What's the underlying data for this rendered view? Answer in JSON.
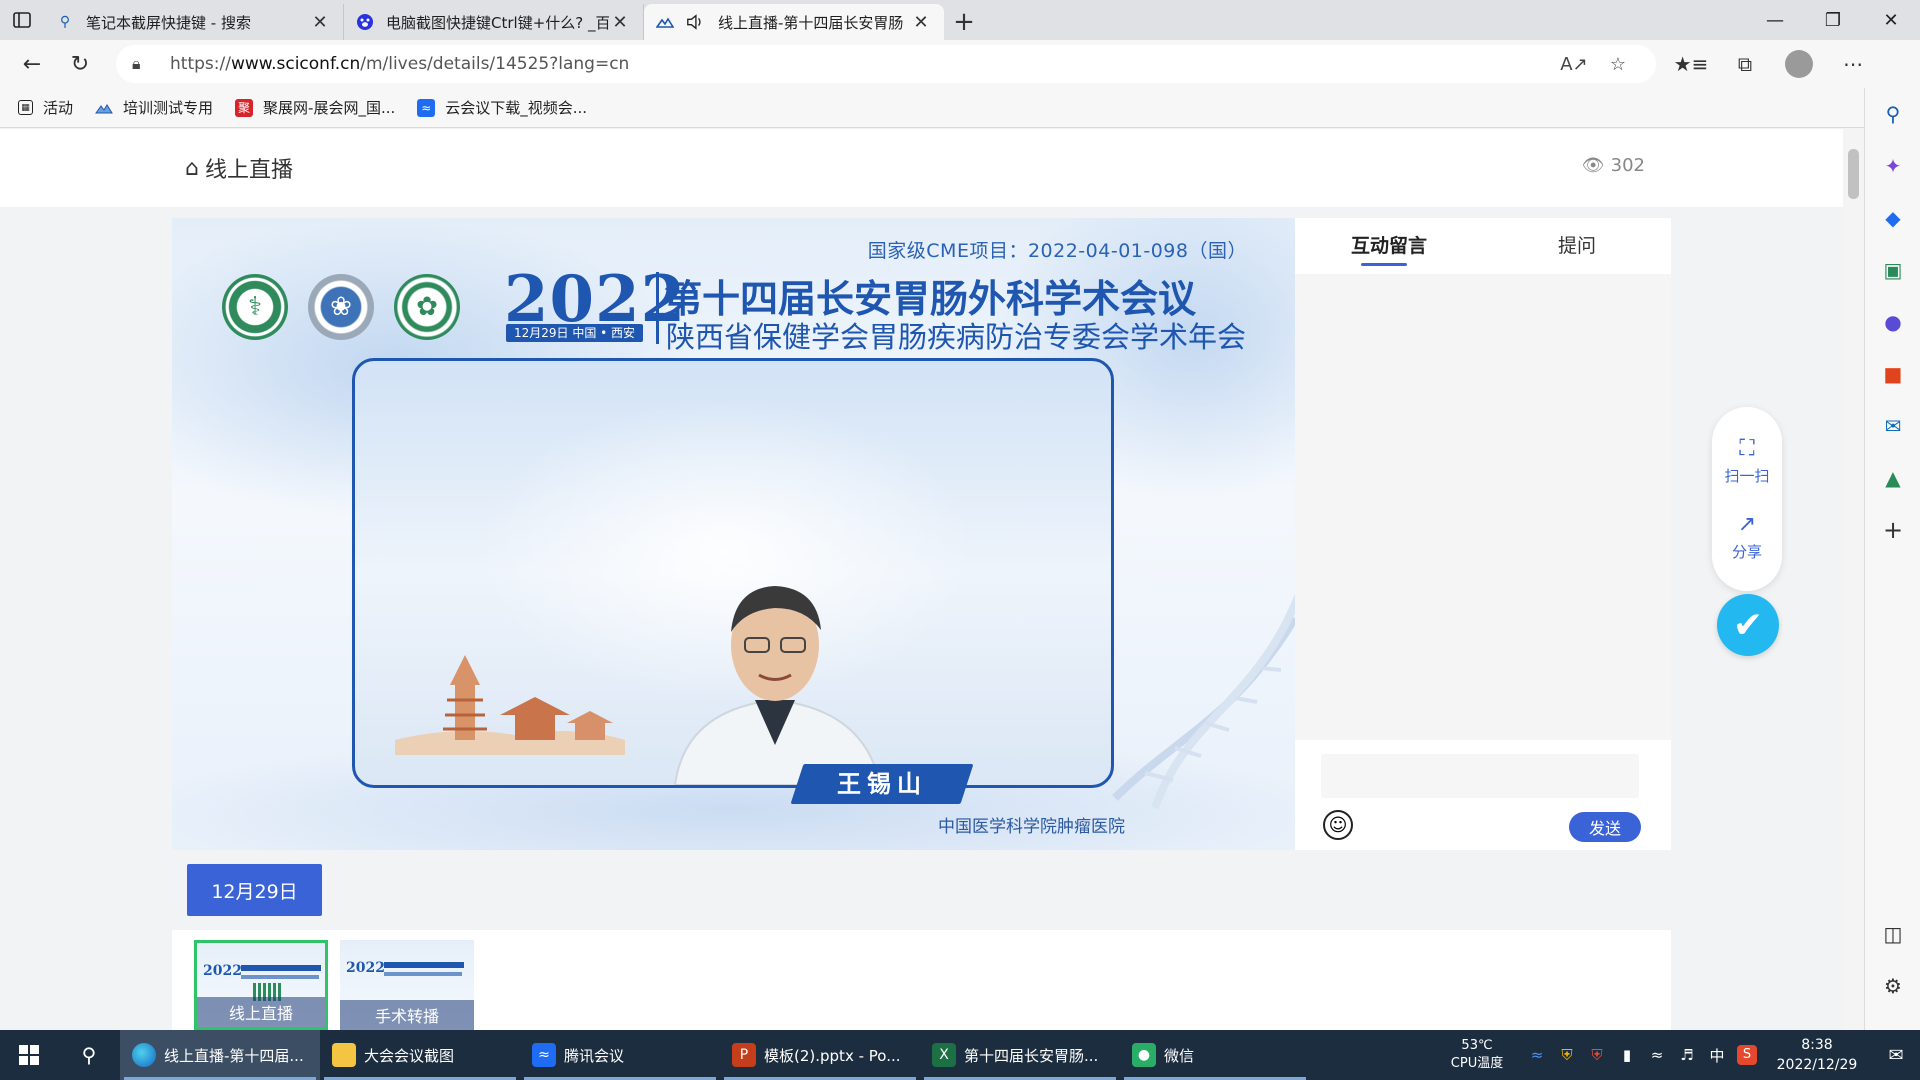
{
  "browser": {
    "tabs": [
      {
        "title": "笔记本截屏快捷键 - 搜索",
        "icon": "search-icon"
      },
      {
        "title": "电脑截图快捷键Ctrl键+什么? _百",
        "icon": "baidu-paw-icon"
      },
      {
        "title": "线上直播-第十四届长安胃肠",
        "icon": "sciconf-logo-icon"
      }
    ],
    "url_prefix": "https://",
    "url_host": "www.sciconf.cn",
    "url_path": "/m/lives/details/14525?lang=cn",
    "bookmarks": [
      {
        "label": "活动",
        "icon": "calendar-icon"
      },
      {
        "label": "培训测试专用",
        "icon": "sciconf-logo-icon"
      },
      {
        "label": "聚展网-展会网_国...",
        "icon": "jz-logo-icon"
      },
      {
        "label": "云会议下载_视频会...",
        "icon": "tencent-meeting-icon"
      }
    ]
  },
  "page": {
    "section_title": "线上直播",
    "view_count": "302"
  },
  "video": {
    "cme_line": "国家级CME项目：2022-04-01-098（国）",
    "year": "2022",
    "year_sub": "12月29日 中国 • 西安",
    "conference_title": "第十四届长安胃肠外科学术会议",
    "conference_subtitle": "陕西省保健学会胃肠疾病防治专委会学术年会",
    "speaker_name": "王锡山",
    "speaker_affiliation": "中国医学科学院肿瘤医院"
  },
  "chat": {
    "tabs": [
      "互动留言",
      "提问"
    ],
    "input_placeholder": "",
    "send_label": "发送"
  },
  "floating": {
    "scan_label": "扫一扫",
    "share_label": "分享"
  },
  "schedule": {
    "date_label": "12月29日",
    "thumbnails": [
      {
        "label": "线上直播",
        "year": "2022"
      },
      {
        "label": "手术转播",
        "year": "2022"
      }
    ]
  },
  "taskbar": {
    "apps": [
      {
        "label": "线上直播-第十四届...",
        "icon": "edge-icon"
      },
      {
        "label": "大会会议截图",
        "icon": "folder-icon"
      },
      {
        "label": "腾讯会议",
        "icon": "tencent-meeting-icon"
      },
      {
        "label": "模板(2).pptx - Po...",
        "icon": "powerpoint-icon"
      },
      {
        "label": "第十四届长安胃肠...",
        "icon": "excel-icon"
      },
      {
        "label": "微信",
        "icon": "wechat-icon"
      }
    ],
    "temperature": "53℃",
    "temperature_label": "CPU温度",
    "ime": "中",
    "time": "8:38",
    "date": "2022/12/29"
  }
}
